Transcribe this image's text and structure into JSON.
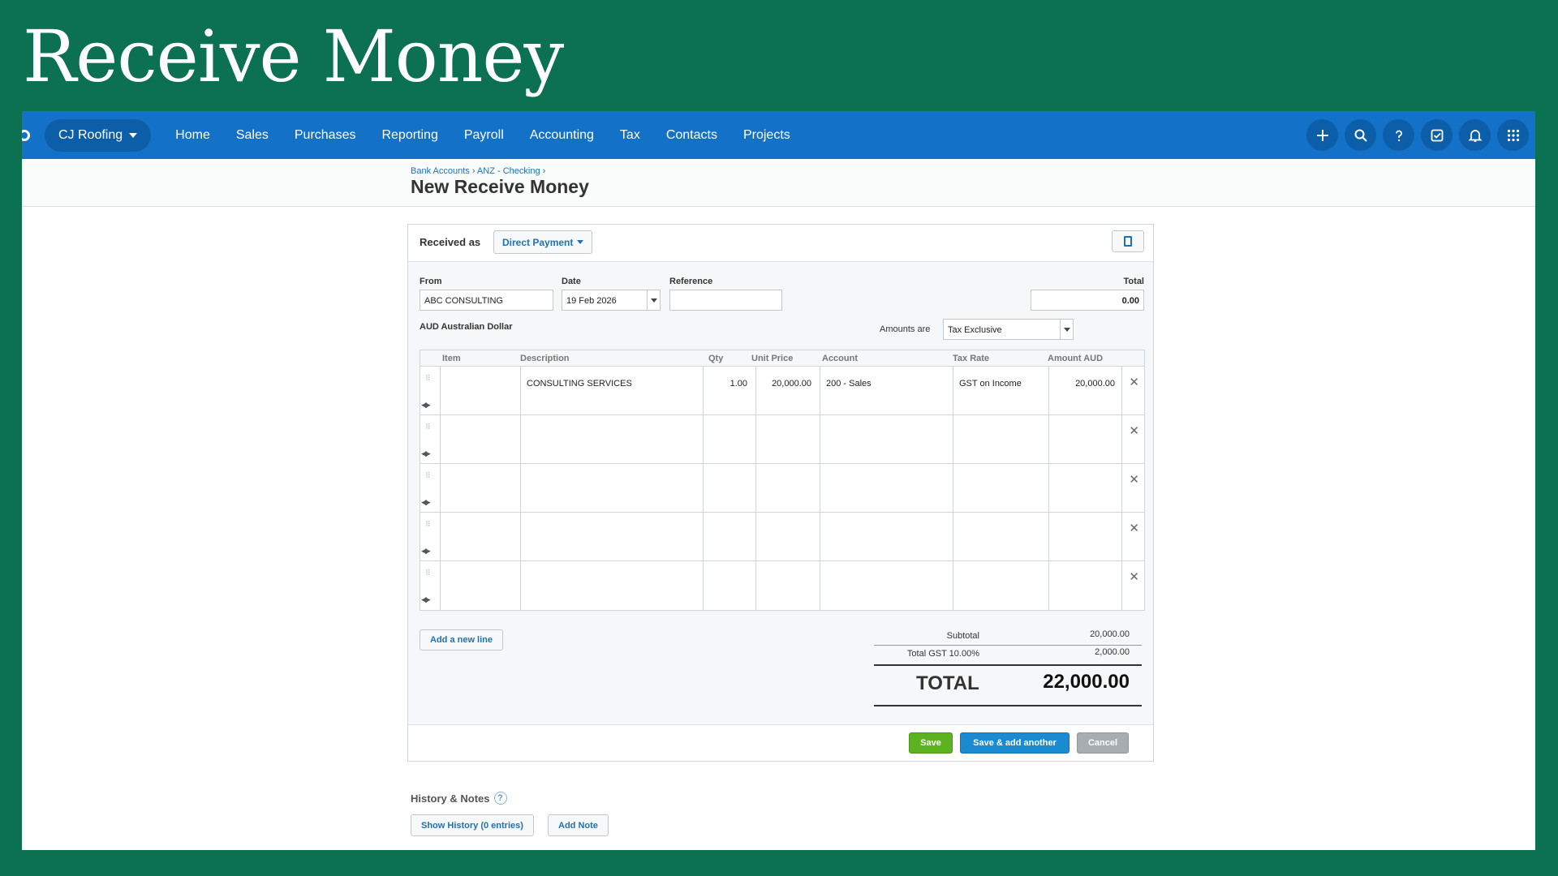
{
  "slide": {
    "title": "Receive Money"
  },
  "nav": {
    "org": "CJ Roofing",
    "menu": [
      "Home",
      "Sales",
      "Purchases",
      "Reporting",
      "Payroll",
      "Accounting",
      "Tax",
      "Contacts",
      "Projects"
    ],
    "icons": [
      "plus-icon",
      "search-icon",
      "help-icon",
      "tasks-icon",
      "bell-icon",
      "apps-grid-icon"
    ]
  },
  "header": {
    "breadcrumb": "Bank Accounts › ANZ - Checking ›",
    "title": "New Receive Money"
  },
  "form": {
    "received_as_label": "Received as",
    "received_as_value": "Direct Payment",
    "from_label": "From",
    "from_value": "ABC CONSULTING",
    "date_label": "Date",
    "date_value": "19 Feb 2026",
    "reference_label": "Reference",
    "reference_value": "",
    "total_label": "Total",
    "total_value": "0.00",
    "currency": "AUD Australian Dollar",
    "amounts_are_label": "Amounts are",
    "amounts_are_value": "Tax Exclusive"
  },
  "table": {
    "headers": [
      "Item",
      "Description",
      "Qty",
      "Unit Price",
      "Account",
      "Tax Rate",
      "Amount AUD"
    ],
    "rows": [
      {
        "item": "",
        "description": "CONSULTING SERVICES",
        "qty": "1.00",
        "unit_price": "20,000.00",
        "account": "200 - Sales",
        "tax_rate": "GST on Income",
        "amount": "20,000.00"
      },
      {
        "item": "",
        "description": "",
        "qty": "",
        "unit_price": "",
        "account": "",
        "tax_rate": "",
        "amount": ""
      },
      {
        "item": "",
        "description": "",
        "qty": "",
        "unit_price": "",
        "account": "",
        "tax_rate": "",
        "amount": ""
      },
      {
        "item": "",
        "description": "",
        "qty": "",
        "unit_price": "",
        "account": "",
        "tax_rate": "",
        "amount": ""
      },
      {
        "item": "",
        "description": "",
        "qty": "",
        "unit_price": "",
        "account": "",
        "tax_rate": "",
        "amount": ""
      }
    ],
    "add_line_label": "Add a new line"
  },
  "totals": {
    "subtotal_label": "Subtotal",
    "subtotal_value": "20,000.00",
    "gst_label": "Total GST 10.00%",
    "gst_value": "2,000.00",
    "total_label": "TOTAL",
    "total_value": "22,000.00"
  },
  "actions": {
    "save": "Save",
    "save_another": "Save & add another",
    "cancel": "Cancel"
  },
  "history": {
    "title": "History & Notes",
    "help": "?",
    "show_history": "Show History (0 entries)",
    "add_note": "Add Note"
  },
  "colors": {
    "slide_bg": "#0b7150",
    "nav_bg": "#1371c7",
    "link": "#1d72b7",
    "save_green": "#5cb31f",
    "save_another_blue": "#1a8ad1",
    "cancel_grey": "#a8adb1"
  }
}
